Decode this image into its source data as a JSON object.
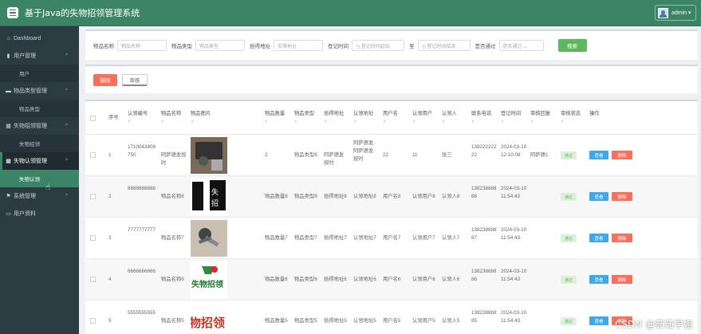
{
  "app": {
    "title": "基于Java的失物招领管理系统",
    "user": "admin ▾"
  },
  "sidebar": {
    "items": [
      {
        "label": "Dashboard",
        "icon": "home-icon",
        "glyph": "⌂",
        "chev": ""
      },
      {
        "label": "用户管理",
        "icon": "bar-chart-icon",
        "glyph": "▮",
        "chev": "^"
      },
      {
        "label": "用户",
        "sub": true
      },
      {
        "label": "物品类型管理",
        "icon": "trash-icon",
        "glyph": "▬",
        "chev": "^"
      },
      {
        "label": "物品类型",
        "sub": true
      },
      {
        "label": "失物招领管理",
        "icon": "grid-icon",
        "glyph": "▦",
        "chev": "^"
      },
      {
        "label": "失物招领",
        "sub": true
      },
      {
        "label": "失物认领管理",
        "icon": "grid-icon",
        "glyph": "▦",
        "chev": "^",
        "active": true
      },
      {
        "label": "失物认领",
        "sub": true,
        "active": true
      },
      {
        "label": "系统管理",
        "icon": "flag-icon",
        "glyph": "⚑",
        "chev": "^"
      },
      {
        "label": "用户资料",
        "icon": "calendar-icon",
        "glyph": "▭",
        "chev": ""
      }
    ]
  },
  "search": {
    "fields": [
      {
        "label": "物品名称",
        "placeholder": "物品名称"
      },
      {
        "label": "物品类型",
        "placeholder": "物品类型"
      },
      {
        "label": "拾得地址",
        "placeholder": "拾得地址"
      },
      {
        "label": "登记时间",
        "placeholder": "登记时间起始"
      },
      {
        "label": "",
        "placeholder": "登记时间结束"
      },
      {
        "label": "是否通过",
        "placeholder": "是否通过"
      }
    ],
    "button": "搜索"
  },
  "actions": {
    "delete": "删除",
    "audit": "审核"
  },
  "table": {
    "headers": [
      "序号",
      "认领编号",
      "物品名称",
      "物品图片",
      "物品数量",
      "物品类型",
      "拾得地址",
      "认领地址",
      "用户名",
      "认领用户",
      "认领人",
      "联系电话",
      "登记时间",
      "审核回复",
      "审核状态",
      "操作"
    ],
    "sort_glyph": "⇕",
    "rows": [
      {
        "index": "1",
        "code": "1710043808750",
        "name": "阿萨德发按时",
        "qty": "2",
        "type": "物品类型8",
        "addr": "阿萨德发按时",
        "claim_addr": "阿萨德发阿萨德发按时",
        "username": "22",
        "claim_user": "11",
        "person": "张三",
        "phone": "13922222222",
        "time": "2024-03-10 12:10:08",
        "reply": "阿萨德1",
        "status": "通过"
      },
      {
        "index": "2",
        "code": "8888888888",
        "name": "物品名称8",
        "qty": "物品数量8",
        "type": "物品类型8",
        "addr": "拾得地址8",
        "claim_addr": "认领地址8",
        "username": "用户名8",
        "claim_user": "认领用户8",
        "person": "认领人8",
        "phone": "13823888888",
        "time": "2024-03-10 11:54:43",
        "reply": "",
        "status": "通过"
      },
      {
        "index": "3",
        "code": "7777777777",
        "name": "物品名称7",
        "qty": "物品数量7",
        "type": "物品类型7",
        "addr": "拾得地址7",
        "claim_addr": "认领地址7",
        "username": "用户名7",
        "claim_user": "认领用户7",
        "person": "认领人7",
        "phone": "13823888887",
        "time": "2024-03-10 11:54:43",
        "reply": "",
        "status": "通过"
      },
      {
        "index": "4",
        "code": "6666666666",
        "name": "物品名称6",
        "qty": "物品数量6",
        "type": "物品类型6",
        "addr": "拾得地址6",
        "claim_addr": "认领地址6",
        "username": "用户名6",
        "claim_user": "认领用户6",
        "person": "认领人6",
        "phone": "13823888886",
        "time": "2024-03-10 11:54:43",
        "reply": "",
        "status": "通过"
      },
      {
        "index": "5",
        "code": "5555555555",
        "name": "物品名称5",
        "qty": "物品数量5",
        "type": "物品类型5",
        "addr": "拾得地址5",
        "claim_addr": "认领地址5",
        "username": "用户名5",
        "claim_user": "认领用户5",
        "person": "认领人5",
        "phone": "13823888885",
        "time": "2024-03-10 11:54:43",
        "reply": "",
        "status": "通过"
      }
    ],
    "row_buttons": {
      "view": "查看",
      "delete": "删除"
    },
    "thumb_text": [
      "",
      "失物招领",
      "",
      "失物招领",
      "失物招领"
    ]
  },
  "watermark": "CSDN @茹茹学姐"
}
